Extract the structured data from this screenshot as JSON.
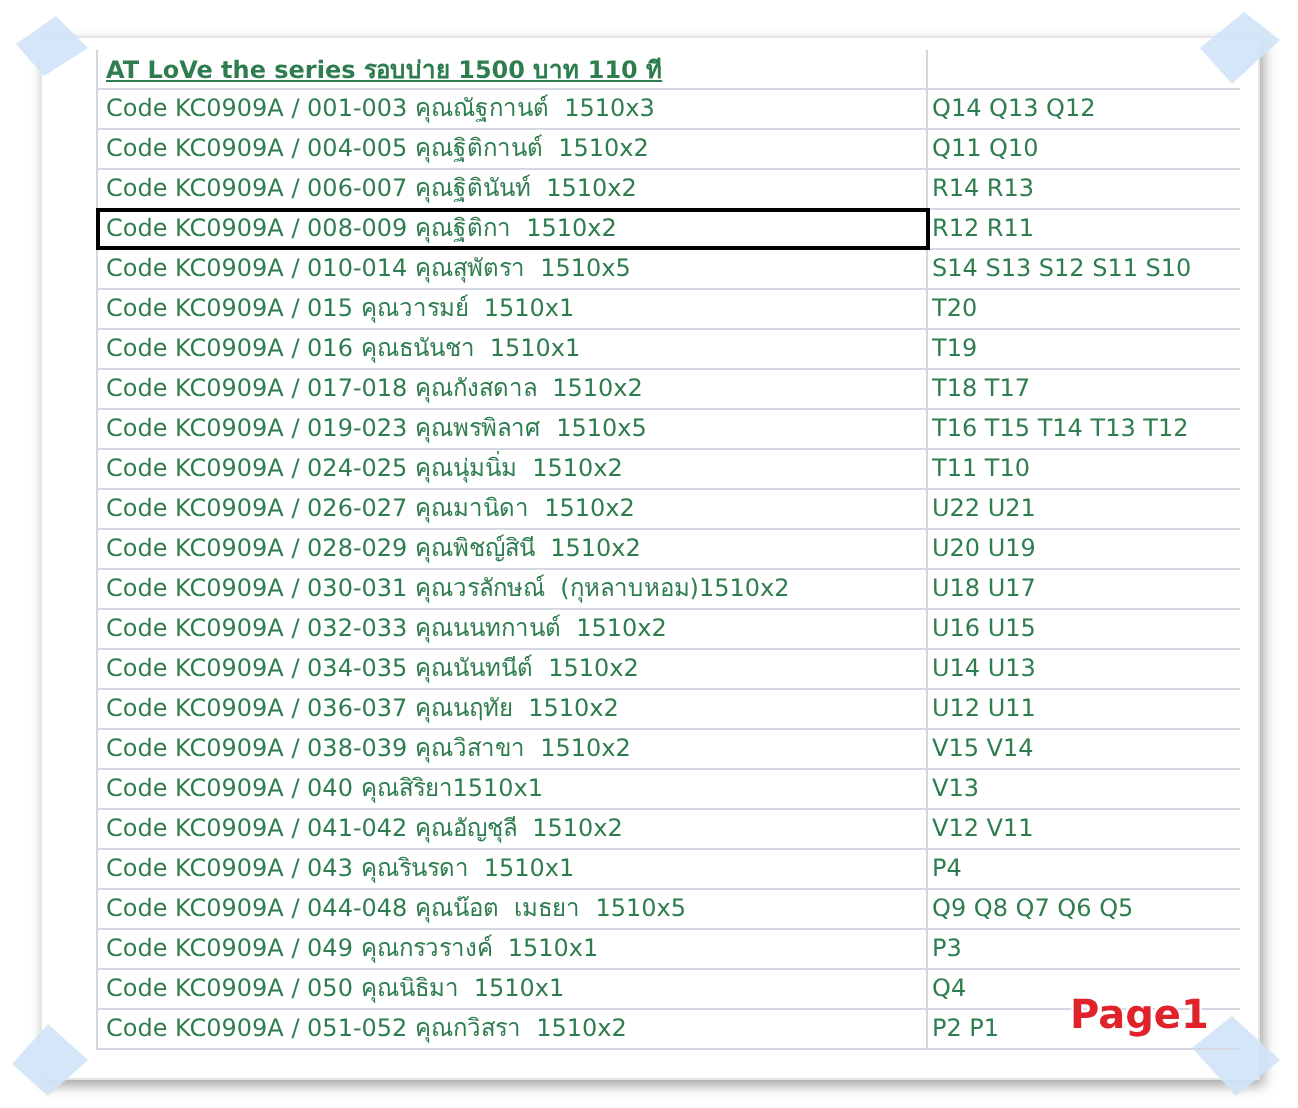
{
  "sheet": {
    "title": "AT LoVe the series รอบบ่าย 1500 บาท 110 ที",
    "rows": [
      {
        "code": "Code KC0909A / 001-003 คุณณัฐกานต์  1510x3",
        "seats": "Q14 Q13 Q12",
        "selected": false
      },
      {
        "code": "Code KC0909A / 004-005 คุณฐิติกานต์  1510x2",
        "seats": "Q11 Q10",
        "selected": false
      },
      {
        "code": "Code KC0909A / 006-007 คุณฐิตินันท์  1510x2",
        "seats": "R14 R13",
        "selected": false
      },
      {
        "code": "Code KC0909A / 008-009 คุณฐิติกา  1510x2",
        "seats": "R12 R11",
        "selected": true
      },
      {
        "code": "Code KC0909A / 010-014 คุณสุพัตรา  1510x5",
        "seats": "S14 S13 S12 S11 S10",
        "selected": false
      },
      {
        "code": "Code KC0909A / 015 คุณวารมย์  1510x1",
        "seats": "T20",
        "selected": false
      },
      {
        "code": "Code KC0909A / 016 คุณธนันชา  1510x1",
        "seats": "T19",
        "selected": false
      },
      {
        "code": "Code KC0909A / 017-018 คุณกังสดาล  1510x2",
        "seats": "T18 T17",
        "selected": false
      },
      {
        "code": "Code KC0909A / 019-023 คุณพรพิลาศ  1510x5",
        "seats": "T16 T15 T14 T13 T12",
        "selected": false
      },
      {
        "code": "Code KC0909A / 024-025 คุณนุ่มนิ่ม  1510x2",
        "seats": "T11 T10",
        "selected": false
      },
      {
        "code": "Code KC0909A / 026-027 คุณมานิดา  1510x2",
        "seats": "U22 U21",
        "selected": false
      },
      {
        "code": "Code KC0909A / 028-029 คุณพิชญ์สินี  1510x2",
        "seats": "U20 U19",
        "selected": false
      },
      {
        "code": "Code KC0909A / 030-031 คุณวรลักษณ์  (กุหลาบหอม)1510x2",
        "seats": "U18 U17",
        "selected": false
      },
      {
        "code": "Code KC0909A / 032-033 คุณนนทกานต์  1510x2",
        "seats": "U16 U15",
        "selected": false
      },
      {
        "code": "Code KC0909A / 034-035 คุณนันทนีต์  1510x2",
        "seats": "U14 U13",
        "selected": false
      },
      {
        "code": "Code KC0909A / 036-037 คุณนฤทัย  1510x2",
        "seats": "U12 U11",
        "selected": false
      },
      {
        "code": "Code KC0909A / 038-039 คุณวิสาขา  1510x2",
        "seats": "V15 V14",
        "selected": false
      },
      {
        "code": "Code KC0909A / 040 คุณสิริยา1510x1",
        "seats": "V13",
        "selected": false
      },
      {
        "code": "Code KC0909A / 041-042 คุณอัญชุลี  1510x2",
        "seats": "V12 V11",
        "selected": false
      },
      {
        "code": "Code KC0909A / 043 คุณรินรดา  1510x1",
        "seats": "P4",
        "selected": false
      },
      {
        "code": "Code KC0909A / 044-048 คุณน๊อต  เมธยา  1510x5",
        "seats": "Q9 Q8 Q7 Q6 Q5",
        "selected": false
      },
      {
        "code": "Code KC0909A / 049 คุณกรวรางค์  1510x1",
        "seats": "P3",
        "selected": false
      },
      {
        "code": "Code KC0909A / 050 คุณนิธิมา  1510x1",
        "seats": "Q4",
        "selected": false
      },
      {
        "code": "Code KC0909A / 051-052 คุณกวิสรา  1510x2",
        "seats": "P2 P1",
        "selected": false
      }
    ]
  },
  "page_label": "Page1"
}
